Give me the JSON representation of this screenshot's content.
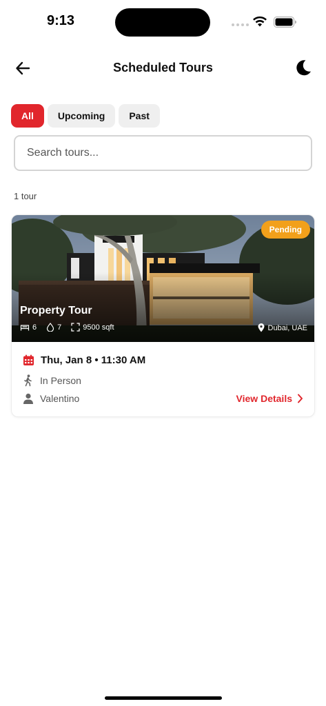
{
  "status_bar": {
    "time": "9:13"
  },
  "header": {
    "title": "Scheduled Tours"
  },
  "tabs": [
    {
      "label": "All",
      "active": true
    },
    {
      "label": "Upcoming",
      "active": false
    },
    {
      "label": "Past",
      "active": false
    }
  ],
  "search": {
    "placeholder": "Search tours...",
    "value": ""
  },
  "tour_count": "1 tour",
  "card": {
    "badge": "Pending",
    "title": "Property Tour",
    "beds": "6",
    "baths": "7",
    "area": "9500 sqft",
    "location": "Dubai, UAE",
    "date": "Thu, Jan 8 • 11:30 AM",
    "tour_type": "In Person",
    "agent": "Valentino",
    "view_details": "View Details"
  },
  "colors": {
    "accent": "#e1262c",
    "pending": "#f2a01b",
    "tab_inactive": "#efefef"
  },
  "icons": [
    "back-arrow-icon",
    "moon-icon",
    "bed-icon",
    "bath-drop-icon",
    "expand-area-icon",
    "location-pin-icon",
    "calendar-icon",
    "walking-person-icon",
    "person-icon",
    "chevron-right-icon",
    "wifi-icon",
    "battery-icon"
  ]
}
